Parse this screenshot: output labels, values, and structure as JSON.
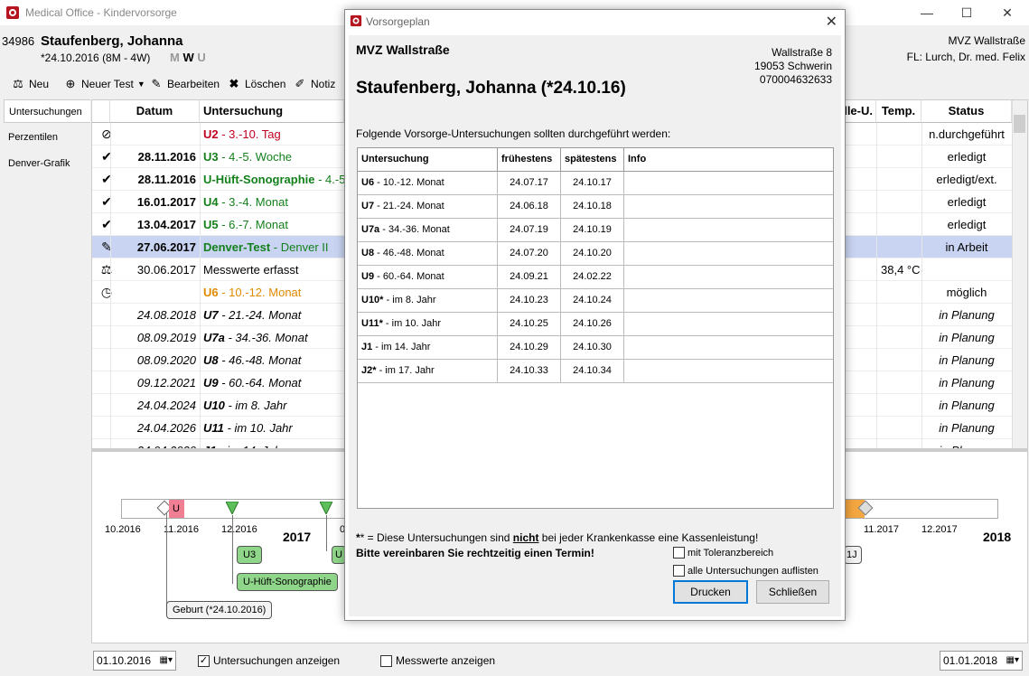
{
  "window": {
    "title": "Medical Office - Kindervorsorge",
    "controls": [
      "—",
      "☐",
      "✕"
    ]
  },
  "patient": {
    "id": "34986",
    "name": "Staufenberg, Johanna",
    "dob_line": "*24.10.2016  (8M - 4W)",
    "mwu": [
      "M",
      "W",
      "U"
    ],
    "practice": "MVZ Wallstraße",
    "doctor": "FL: Lurch, Dr. med. Felix"
  },
  "toolbar": {
    "new": "Neu",
    "new_test": "Neuer Test",
    "edit": "Bearbeiten",
    "delete": "Löschen",
    "note": "Notiz"
  },
  "sidenav": [
    "Untersuchungen",
    "Perzentilen",
    "Denver-Grafik"
  ],
  "grid": {
    "headers": {
      "date": "Datum",
      "exam": "Untersuchung",
      "partial": "lle-U.",
      "temp": "Temp.",
      "status": "Status"
    },
    "rows": [
      {
        "icon": "⊘",
        "date": "",
        "code": "U2",
        "desc": " - 3.-10. Tag",
        "color": "#c00020",
        "temp": "",
        "status": "n.durchgeführt",
        "style": "normal"
      },
      {
        "icon": "✔",
        "date": "28.11.2016",
        "code": "U3",
        "desc": " - 4.-5. Woche",
        "color": "#14801c",
        "temp": "",
        "status": "erledigt",
        "style": "bold"
      },
      {
        "icon": "✔",
        "date": "28.11.2016",
        "code": "U-Hüft-Sonographie",
        "desc": " - 4.-5.",
        "color": "#14801c",
        "temp": "",
        "status": "erledigt/ext.",
        "style": "bold"
      },
      {
        "icon": "✔",
        "date": "16.01.2017",
        "code": "U4",
        "desc": " - 3.-4. Monat",
        "color": "#14801c",
        "temp": "",
        "status": "erledigt",
        "style": "bold"
      },
      {
        "icon": "✔",
        "date": "13.04.2017",
        "code": "U5",
        "desc": " - 6.-7. Monat",
        "color": "#14801c",
        "temp": "",
        "status": "erledigt",
        "style": "bold"
      },
      {
        "icon": "✎",
        "date": "27.06.2017",
        "code": "Denver-Test",
        "desc": " - Denver II",
        "color": "#14801c",
        "temp": "",
        "status": "in Arbeit",
        "style": "bold"
      },
      {
        "icon": "⚖",
        "date": "30.06.2017",
        "code": "Messwerte erfasst",
        "desc": "",
        "color": "#000000",
        "temp": "38,4 °C",
        "status": "",
        "style": "plain"
      },
      {
        "icon": "◷",
        "date": "",
        "code": "U6",
        "desc": " - 10.-12. Monat",
        "color": "#e08a00",
        "temp": "",
        "status": "möglich",
        "style": "normal"
      },
      {
        "icon": "",
        "date": "24.08.2018",
        "code": "U7",
        "desc": " - 21.-24. Monat",
        "color": "#000000",
        "temp": "",
        "status": "in Planung",
        "style": "italic"
      },
      {
        "icon": "",
        "date": "08.09.2019",
        "code": "U7a",
        "desc": " - 34.-36. Monat",
        "color": "#000000",
        "temp": "",
        "status": "in Planung",
        "style": "italic"
      },
      {
        "icon": "",
        "date": "08.09.2020",
        "code": "U8",
        "desc": " - 46.-48. Monat",
        "color": "#000000",
        "temp": "",
        "status": "in Planung",
        "style": "italic"
      },
      {
        "icon": "",
        "date": "09.12.2021",
        "code": "U9",
        "desc": " - 60.-64. Monat",
        "color": "#000000",
        "temp": "",
        "status": "in Planung",
        "style": "italic"
      },
      {
        "icon": "",
        "date": "24.04.2024",
        "code": "U10",
        "desc": " - im 8. Jahr",
        "color": "#000000",
        "temp": "",
        "status": "in Planung",
        "style": "italic"
      },
      {
        "icon": "",
        "date": "24.04.2026",
        "code": "U11",
        "desc": " - im 10. Jahr",
        "color": "#000000",
        "temp": "",
        "status": "in Planung",
        "style": "italic"
      },
      {
        "icon": "",
        "date": "24.04.2030",
        "code": "J1",
        "desc": " - im 14. Jahr",
        "color": "#000000",
        "temp": "",
        "status": "in Planung",
        "style": "italic"
      }
    ]
  },
  "timeline": {
    "ticks": [
      "10.2016",
      "11.2016",
      "12.2016",
      "11.2017",
      "12.2017"
    ],
    "years": [
      "2017",
      "2018"
    ],
    "partial_labels": [
      "U",
      "0",
      "U",
      "1J"
    ],
    "boxes": [
      "U3",
      "U-Hüft-Sonographie",
      "Geburt (*24.10.2016)"
    ]
  },
  "bottombar": {
    "from_date": "01.10.2016",
    "to_date": "01.01.2018",
    "show_exams": "Untersuchungen anzeigen",
    "show_measurements": "Messwerte anzeigen"
  },
  "dialog": {
    "title": "Vorsorgeplan",
    "practice": "MVZ Wallstraße",
    "address": [
      "Wallstraße 8",
      "19053 Schwerin",
      "070004632633"
    ],
    "patient_line": "Staufenberg, Johanna  (*24.10.16)",
    "intro": "Folgende Vorsorge-Untersuchungen sollten durchgeführt werden:",
    "table": {
      "headers": [
        "Untersuchung",
        "frühestens",
        "spätestens",
        "Info"
      ],
      "rows": [
        {
          "code": "U6",
          "desc": " - 10.-12. Monat",
          "earliest": "24.07.17",
          "latest": "24.10.17",
          "info": ""
        },
        {
          "code": "U7",
          "desc": " - 21.-24. Monat",
          "earliest": "24.06.18",
          "latest": "24.10.18",
          "info": ""
        },
        {
          "code": "U7a",
          "desc": " - 34.-36. Monat",
          "earliest": "24.07.19",
          "latest": "24.10.19",
          "info": ""
        },
        {
          "code": "U8",
          "desc": " - 46.-48. Monat",
          "earliest": "24.07.20",
          "latest": "24.10.20",
          "info": ""
        },
        {
          "code": "U9",
          "desc": " - 60.-64. Monat",
          "earliest": "24.09.21",
          "latest": "24.02.22",
          "info": ""
        },
        {
          "code": "U10*",
          "desc": " - im 8. Jahr",
          "earliest": "24.10.23",
          "latest": "24.10.24",
          "info": ""
        },
        {
          "code": "U11*",
          "desc": " - im 10. Jahr",
          "earliest": "24.10.25",
          "latest": "24.10.26",
          "info": ""
        },
        {
          "code": "J1",
          "desc": " - im 14. Jahr",
          "earliest": "24.10.29",
          "latest": "24.10.30",
          "info": ""
        },
        {
          "code": "J2*",
          "desc": " - im 17. Jahr",
          "earliest": "24.10.33",
          "latest": "24.10.34",
          "info": ""
        }
      ]
    },
    "note_prefix": "* = Diese Untersuchungen sind ",
    "note_emph": "nicht",
    "note_suffix": " bei jeder Krankenkasse eine Kassenleistung!",
    "appointment": "Bitte vereinbaren Sie rechtzeitig einen Termin!",
    "chk_tolerance": "mit Toleranzbereich",
    "chk_all": "alle Untersuchungen auflisten",
    "print": "Drucken",
    "close": "Schließen"
  },
  "colors": {
    "selection": "#c9d4f2",
    "done_green": "#14801c",
    "missed_red": "#c00020",
    "possible_orange": "#e08a00",
    "accent_blue": "#0078d7"
  }
}
